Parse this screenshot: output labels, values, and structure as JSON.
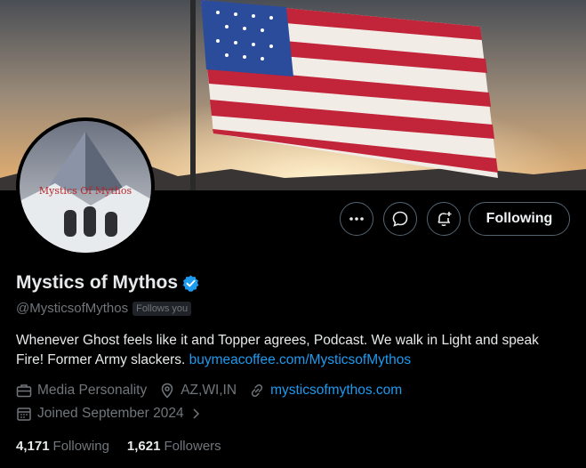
{
  "profile": {
    "name": "Mystics of Mythos",
    "handle": "@MysticsofMythos",
    "follows_you": "Follows you",
    "bio_text": "Whenever Ghost feels like it and Topper agrees, Podcast. We walk in Light and speak Fire! Former Army slackers.",
    "bio_link": "buymeacoffee.com/MysticsofMythos",
    "avatar_text": "Mystics Of Mythos"
  },
  "meta": {
    "category": "Media Personality",
    "location": "AZ,WI,IN",
    "website": "mysticsofmythos.com",
    "joined": "Joined September 2024"
  },
  "actions": {
    "following_label": "Following"
  },
  "stats": {
    "following_count": "4,171",
    "following_label": "Following",
    "followers_count": "1,621",
    "followers_label": "Followers"
  },
  "icons": {
    "more": "more-icon",
    "message": "message-icon",
    "notify": "bell-plus-icon",
    "verified": "verified-badge-icon",
    "category": "briefcase-icon",
    "location": "location-pin-icon",
    "website": "link-icon",
    "joined": "calendar-icon"
  },
  "colors": {
    "accent": "#1d9bf0",
    "muted": "#71767b",
    "text": "#e7e9ea",
    "background": "#000000"
  }
}
